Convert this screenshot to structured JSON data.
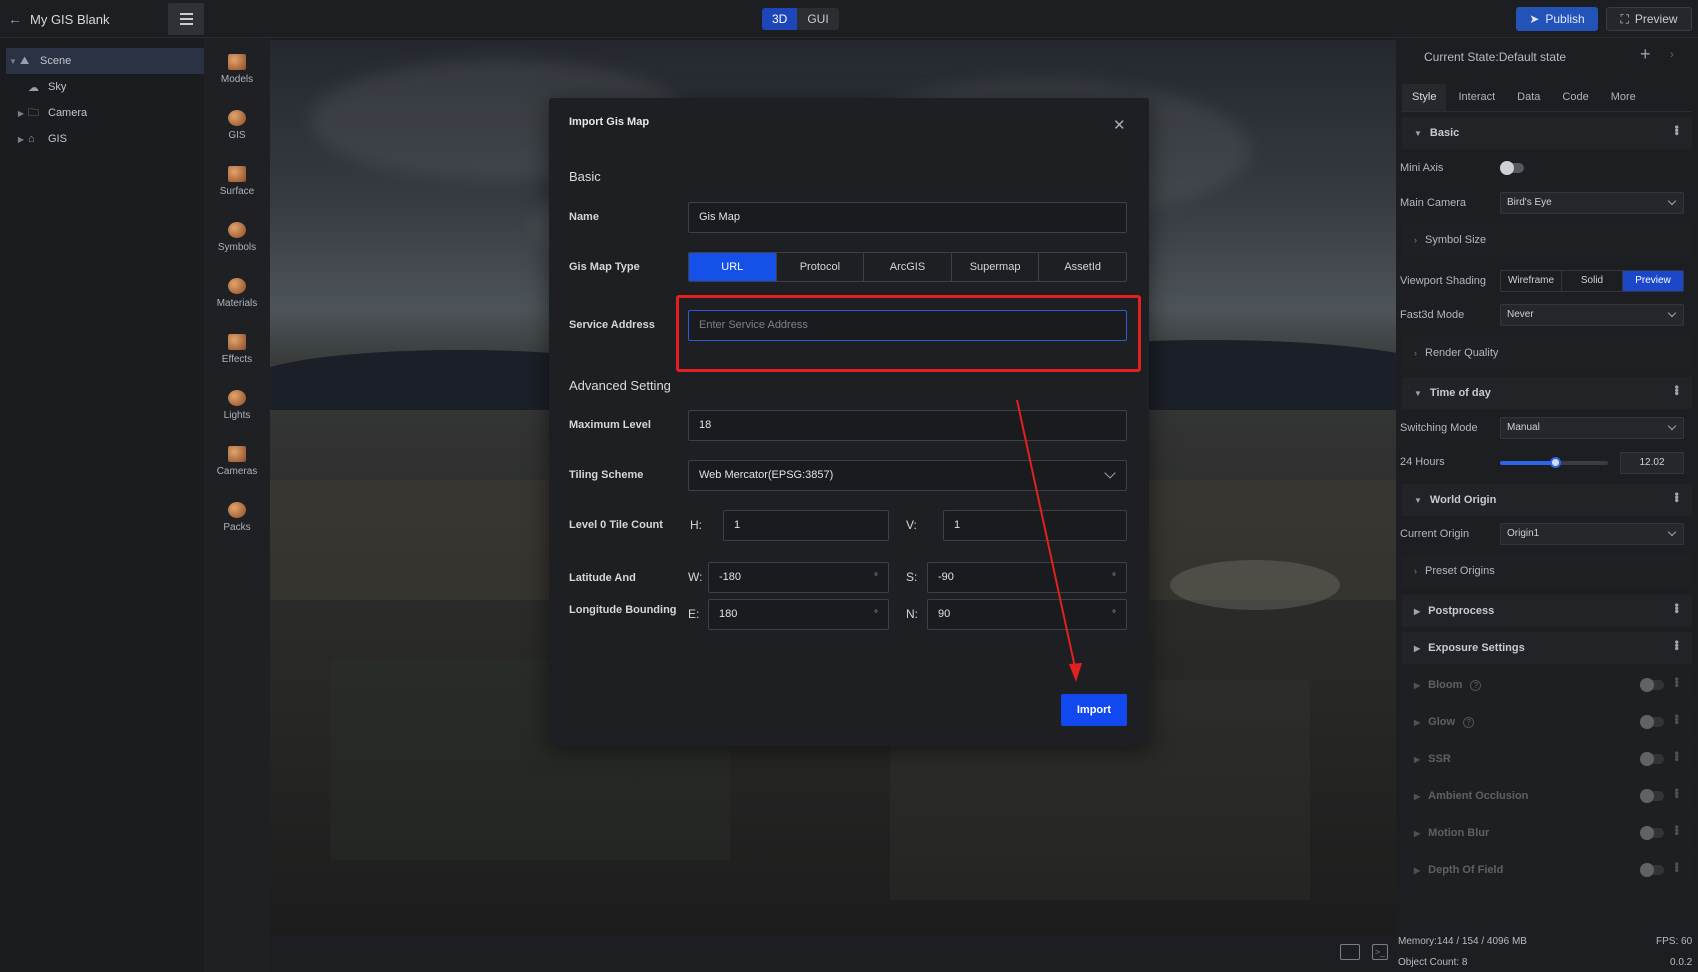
{
  "app": {
    "title": "My GIS Blank"
  },
  "topbar": {
    "mode_3d": "3D",
    "mode_gui": "GUI",
    "publish": "Publish",
    "preview": "Preview"
  },
  "tree": [
    {
      "label": "Scene",
      "icon": "scene-icon",
      "selected": true
    },
    {
      "label": "Sky",
      "icon": "sky-icon"
    },
    {
      "label": "Camera",
      "icon": "folder-icon"
    },
    {
      "label": "GIS",
      "icon": "gis-icon"
    }
  ],
  "toolbox": [
    "Models",
    "GIS",
    "Surface",
    "Symbols",
    "Materials",
    "Effects",
    "Lights",
    "Cameras",
    "Packs"
  ],
  "dialog": {
    "title": "Import Gis Map",
    "basic_title": "Basic",
    "name_label": "Name",
    "name_value": "Gis Map",
    "type_label": "Gis Map Type",
    "types": [
      "URL",
      "Protocol",
      "ArcGIS",
      "Supermap",
      "AssetId"
    ],
    "type_selected": "URL",
    "service_label": "Service Address",
    "service_placeholder": "Enter Service Address",
    "advanced_title": "Advanced Setting",
    "max_level_label": "Maximum Level",
    "max_level_value": "18",
    "tiling_label": "Tiling Scheme",
    "tiling_value": "Web Mercator(EPSG:3857)",
    "tile_count_label": "Level 0 Tile Count",
    "h_label": "H:",
    "h_value": "1",
    "v_label": "V:",
    "v_value": "1",
    "bounding_label_1": "Latitude And",
    "bounding_label_2": "Longitude Bounding",
    "w_label": "W:",
    "w_value": "-180",
    "s_label": "S:",
    "s_value": "-90",
    "e_label": "E:",
    "e_value": "180",
    "n_label": "N:",
    "n_value": "90",
    "degree_unit": "°",
    "import_label": "Import"
  },
  "right_panel": {
    "state_title": "Current State:Default state",
    "tabs": [
      "Style",
      "Interact",
      "Data",
      "Code",
      "More"
    ],
    "basic": "Basic",
    "mini_axis": "Mini Axis",
    "main_camera": "Main Camera",
    "main_camera_value": "Bird's Eye",
    "symbol_size": "Symbol Size",
    "viewport_shading": "Viewport Shading",
    "shading_options": [
      "Wireframe",
      "Solid",
      "Preview"
    ],
    "fast3d_mode": "Fast3d Mode",
    "fast3d_value": "Never",
    "render_quality": "Render Quality",
    "time_of_day": "Time of day",
    "switching_mode": "Switching Mode",
    "switching_value": "Manual",
    "hours_label": "24 Hours",
    "hours_value": "12.02",
    "world_origin": "World Origin",
    "current_origin": "Current Origin",
    "current_origin_value": "Origin1",
    "preset_origins": "Preset Origins",
    "postprocess": "Postprocess",
    "exposure": "Exposure Settings",
    "bloom": "Bloom",
    "glow": "Glow",
    "ssr": "SSR",
    "ao": "Ambient Occlusion",
    "motion_blur": "Motion Blur",
    "dof": "Depth Of Field"
  },
  "status": {
    "memory": "Memory:144 / 154 / 4096 MB",
    "fps": "FPS: 60",
    "object_count": "Object Count: 8",
    "version": "0.0.2"
  },
  "colors": {
    "accent": "#1551e8",
    "highlight": "#e2201f"
  }
}
